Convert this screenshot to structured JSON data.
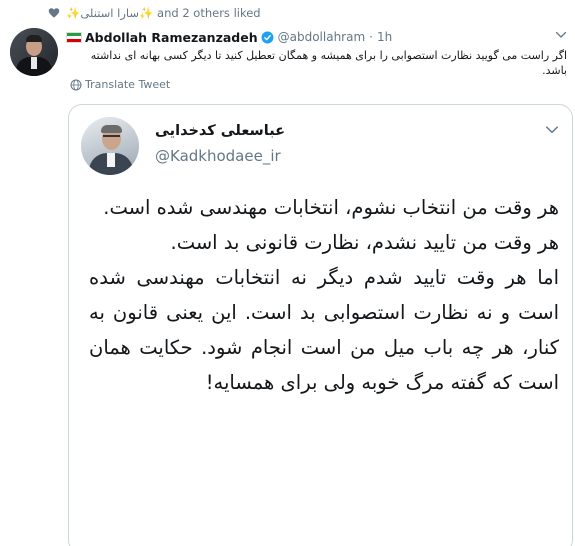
{
  "liked": {
    "user": "سارا استنلی",
    "sparkle": "✨",
    "suffix": "and 2 others liked"
  },
  "tweet": {
    "author_name": "Abdollah Ramezanzadeh",
    "handle": "@abdollahram",
    "separator": "·",
    "time": "1h",
    "text": "اگر راست می گویید نظارت استصوابی را برای همیشه و همگان تعطیل کنید تا دیگر کسی بهانه ای نداشته باشد.",
    "translate_label": "Translate Tweet"
  },
  "quoted": {
    "name": "عباسعلی کدخدایی",
    "handle": "@Kadkhodaee_ir",
    "text": "هر وقت من انتخاب نشوم، انتخابات مهندسی شده است.\nهر وقت من تایید نشدم، نظارت قانونی بد است.\nاما هر وقت تایید شدم دیگر نه انتخابات مهندسی شده است و نه نظارت استصوابی بد است. این یعنی قانون به کنار، هر چه باب میل من است انجام شود. حکایت همان است که گفته مرگ خوبه ولی برای همسایه!"
  },
  "colors": {
    "text": "#14171a",
    "secondary": "#657786",
    "verified": "#1da1f2",
    "border": "#ccd6dd"
  },
  "icons": [
    "heart-icon",
    "iran-flag-icon",
    "verified-badge-icon",
    "chevron-down-icon",
    "globe-icon"
  ]
}
